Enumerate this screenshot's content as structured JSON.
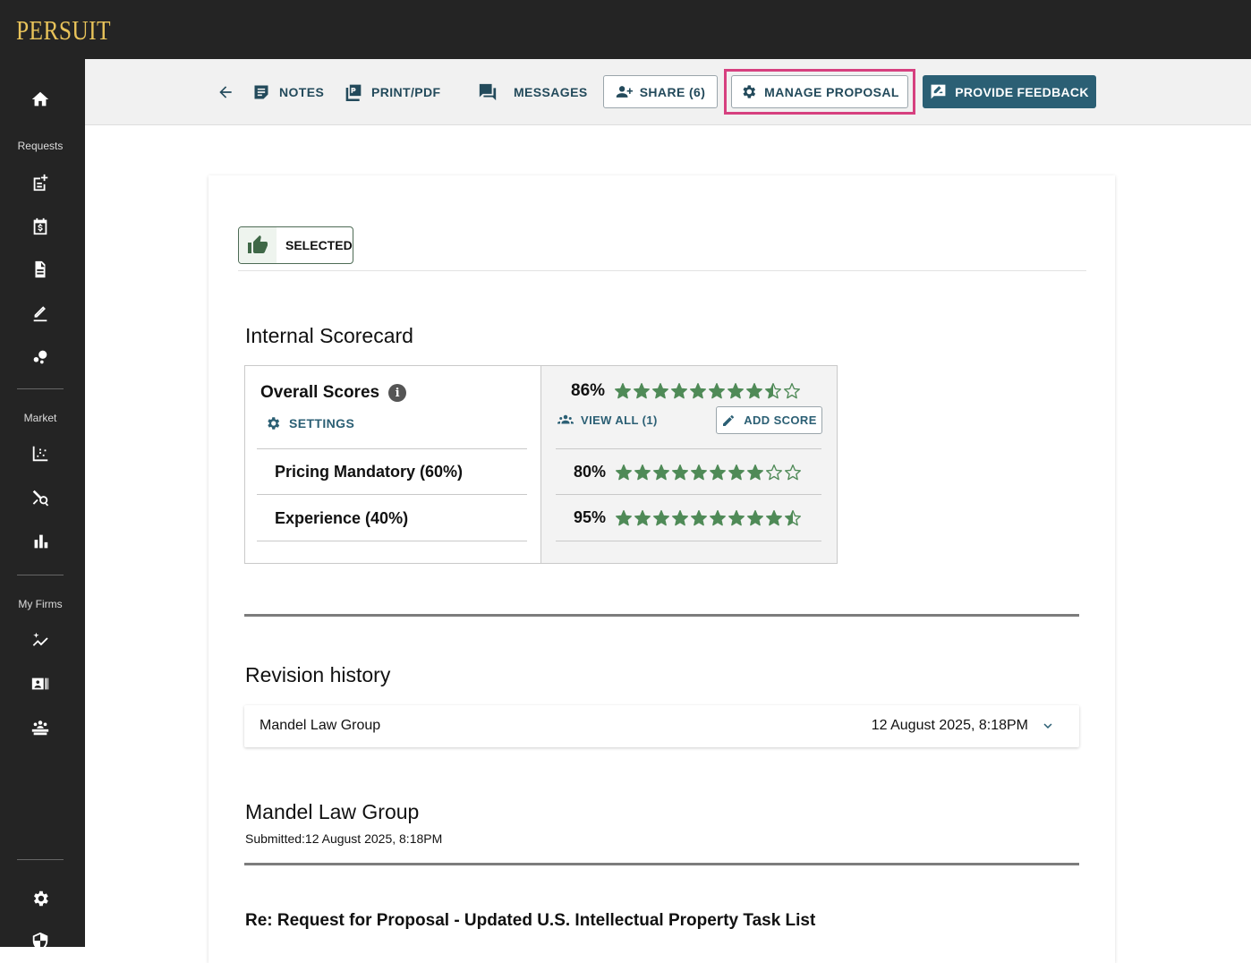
{
  "app": {
    "logo": "PERSUIT"
  },
  "sidebar": {
    "sections": [
      "Requests",
      "Market",
      "My Firms"
    ],
    "icons": [
      "home-icon",
      "new-request-icon",
      "calendar-dollar-icon",
      "document-icon",
      "edit-icon",
      "bubbles-icon",
      "scatter-chart-icon",
      "search-analytics-icon",
      "bar-chart-icon",
      "sparkle-chart-icon",
      "firm-card-icon",
      "team-icon",
      "settings-icon",
      "shield-icon"
    ]
  },
  "toolbar": {
    "notes": "NOTES",
    "print": "PRINT/PDF",
    "messages": "MESSAGES",
    "share": "SHARE (6)",
    "manage": "MANAGE PROPOSAL",
    "feedback": "PROVIDE FEEDBACK"
  },
  "status": {
    "selected": "SELECTED"
  },
  "scorecard": {
    "title": "Internal Scorecard",
    "overall_label": "Overall Scores",
    "settings": "SETTINGS",
    "overall_pct": "86%",
    "overall_stars": 8.6,
    "view_all": "VIEW ALL (1)",
    "add_score": "ADD SCORE",
    "criteria": [
      {
        "label": "Pricing Mandatory (60%)",
        "pct": "80%",
        "stars": 8
      },
      {
        "label": "Experience (40%)",
        "pct": "95%",
        "stars": 9.5
      }
    ],
    "star_color": "#4f8a57"
  },
  "revision": {
    "title": "Revision history",
    "firm": "Mandel Law Group",
    "date": "12 August 2025, 8:18PM"
  },
  "proposal": {
    "firm": "Mandel Law Group",
    "submitted": "Submitted:12 August 2025, 8:18PM",
    "subject": "Re: Request for Proposal - Updated U.S. Intellectual Property Task List"
  }
}
